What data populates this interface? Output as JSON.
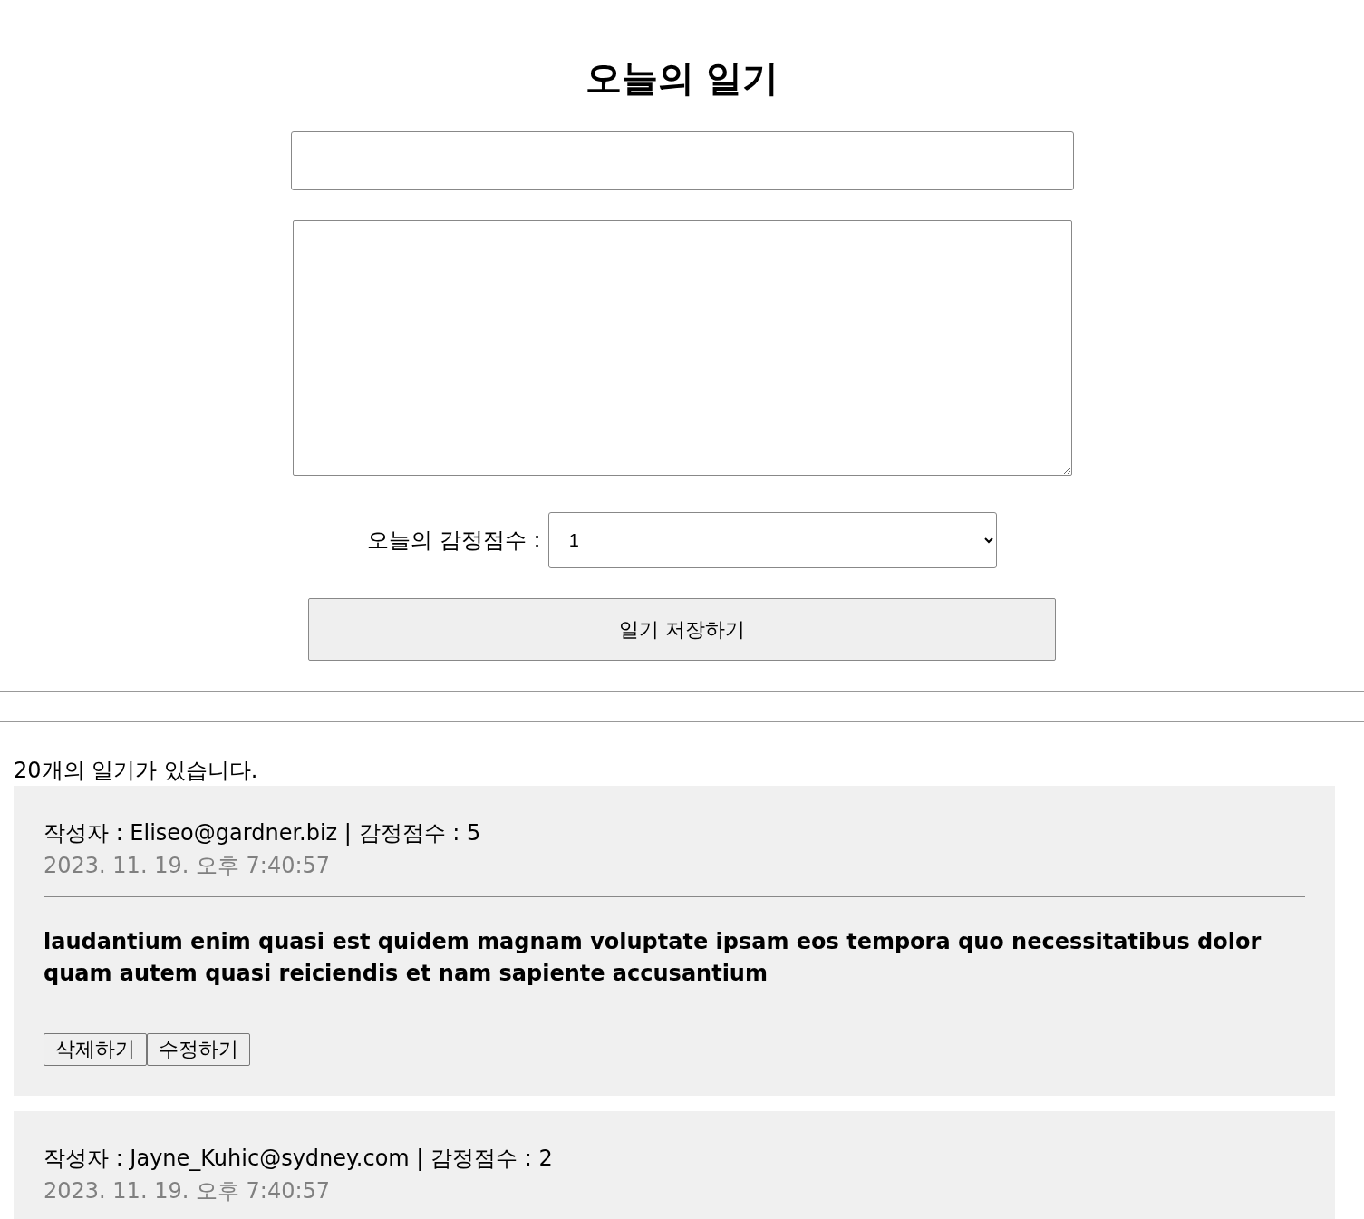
{
  "title": "오늘의 일기",
  "editor": {
    "emotion_label": "오늘의 감정점수 :",
    "emotion_value": "1",
    "save_button": "일기 저장하기"
  },
  "count_text": "20개의 일기가 있습니다.",
  "diaries": [
    {
      "info": "작성자 : Eliseo@gardner.biz | 감정점수 : 5",
      "date": "2023. 11. 19. 오후 7:40:57",
      "content": "laudantium enim quasi est quidem magnam voluptate ipsam eos tempora quo necessitatibus dolor quam autem quasi reiciendis et nam sapiente accusantium",
      "buttons": [
        "삭제하기",
        "수정하기"
      ]
    },
    {
      "info": "작성자 : Jayne_Kuhic@sydney.com | 감정점수 : 2",
      "date": "2023. 11. 19. 오후 7:40:57"
    }
  ]
}
